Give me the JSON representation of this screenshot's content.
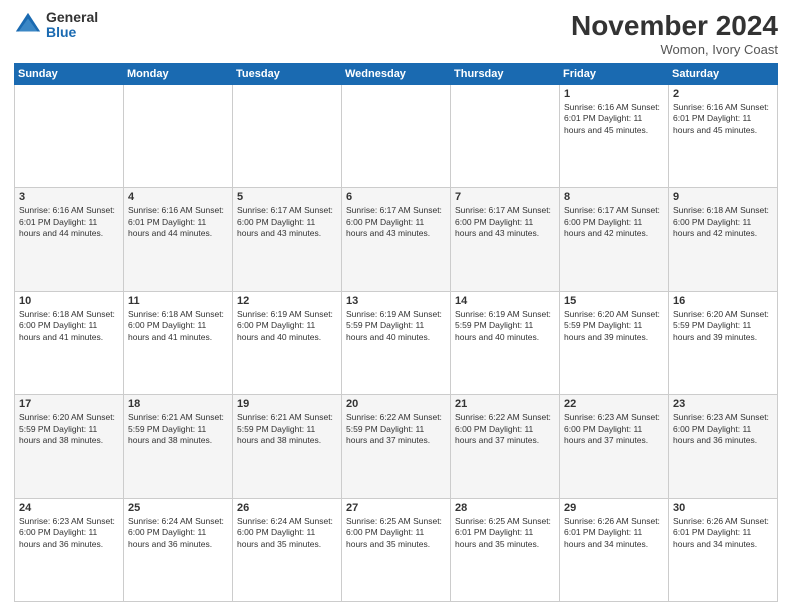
{
  "logo": {
    "general": "General",
    "blue": "Blue"
  },
  "title": "November 2024",
  "location": "Womon, Ivory Coast",
  "days_header": [
    "Sunday",
    "Monday",
    "Tuesday",
    "Wednesday",
    "Thursday",
    "Friday",
    "Saturday"
  ],
  "weeks": [
    [
      {
        "day": "",
        "info": ""
      },
      {
        "day": "",
        "info": ""
      },
      {
        "day": "",
        "info": ""
      },
      {
        "day": "",
        "info": ""
      },
      {
        "day": "",
        "info": ""
      },
      {
        "day": "1",
        "info": "Sunrise: 6:16 AM\nSunset: 6:01 PM\nDaylight: 11 hours\nand 45 minutes."
      },
      {
        "day": "2",
        "info": "Sunrise: 6:16 AM\nSunset: 6:01 PM\nDaylight: 11 hours\nand 45 minutes."
      }
    ],
    [
      {
        "day": "3",
        "info": "Sunrise: 6:16 AM\nSunset: 6:01 PM\nDaylight: 11 hours\nand 44 minutes."
      },
      {
        "day": "4",
        "info": "Sunrise: 6:16 AM\nSunset: 6:01 PM\nDaylight: 11 hours\nand 44 minutes."
      },
      {
        "day": "5",
        "info": "Sunrise: 6:17 AM\nSunset: 6:00 PM\nDaylight: 11 hours\nand 43 minutes."
      },
      {
        "day": "6",
        "info": "Sunrise: 6:17 AM\nSunset: 6:00 PM\nDaylight: 11 hours\nand 43 minutes."
      },
      {
        "day": "7",
        "info": "Sunrise: 6:17 AM\nSunset: 6:00 PM\nDaylight: 11 hours\nand 43 minutes."
      },
      {
        "day": "8",
        "info": "Sunrise: 6:17 AM\nSunset: 6:00 PM\nDaylight: 11 hours\nand 42 minutes."
      },
      {
        "day": "9",
        "info": "Sunrise: 6:18 AM\nSunset: 6:00 PM\nDaylight: 11 hours\nand 42 minutes."
      }
    ],
    [
      {
        "day": "10",
        "info": "Sunrise: 6:18 AM\nSunset: 6:00 PM\nDaylight: 11 hours\nand 41 minutes."
      },
      {
        "day": "11",
        "info": "Sunrise: 6:18 AM\nSunset: 6:00 PM\nDaylight: 11 hours\nand 41 minutes."
      },
      {
        "day": "12",
        "info": "Sunrise: 6:19 AM\nSunset: 6:00 PM\nDaylight: 11 hours\nand 40 minutes."
      },
      {
        "day": "13",
        "info": "Sunrise: 6:19 AM\nSunset: 5:59 PM\nDaylight: 11 hours\nand 40 minutes."
      },
      {
        "day": "14",
        "info": "Sunrise: 6:19 AM\nSunset: 5:59 PM\nDaylight: 11 hours\nand 40 minutes."
      },
      {
        "day": "15",
        "info": "Sunrise: 6:20 AM\nSunset: 5:59 PM\nDaylight: 11 hours\nand 39 minutes."
      },
      {
        "day": "16",
        "info": "Sunrise: 6:20 AM\nSunset: 5:59 PM\nDaylight: 11 hours\nand 39 minutes."
      }
    ],
    [
      {
        "day": "17",
        "info": "Sunrise: 6:20 AM\nSunset: 5:59 PM\nDaylight: 11 hours\nand 38 minutes."
      },
      {
        "day": "18",
        "info": "Sunrise: 6:21 AM\nSunset: 5:59 PM\nDaylight: 11 hours\nand 38 minutes."
      },
      {
        "day": "19",
        "info": "Sunrise: 6:21 AM\nSunset: 5:59 PM\nDaylight: 11 hours\nand 38 minutes."
      },
      {
        "day": "20",
        "info": "Sunrise: 6:22 AM\nSunset: 5:59 PM\nDaylight: 11 hours\nand 37 minutes."
      },
      {
        "day": "21",
        "info": "Sunrise: 6:22 AM\nSunset: 6:00 PM\nDaylight: 11 hours\nand 37 minutes."
      },
      {
        "day": "22",
        "info": "Sunrise: 6:23 AM\nSunset: 6:00 PM\nDaylight: 11 hours\nand 37 minutes."
      },
      {
        "day": "23",
        "info": "Sunrise: 6:23 AM\nSunset: 6:00 PM\nDaylight: 11 hours\nand 36 minutes."
      }
    ],
    [
      {
        "day": "24",
        "info": "Sunrise: 6:23 AM\nSunset: 6:00 PM\nDaylight: 11 hours\nand 36 minutes."
      },
      {
        "day": "25",
        "info": "Sunrise: 6:24 AM\nSunset: 6:00 PM\nDaylight: 11 hours\nand 36 minutes."
      },
      {
        "day": "26",
        "info": "Sunrise: 6:24 AM\nSunset: 6:00 PM\nDaylight: 11 hours\nand 35 minutes."
      },
      {
        "day": "27",
        "info": "Sunrise: 6:25 AM\nSunset: 6:00 PM\nDaylight: 11 hours\nand 35 minutes."
      },
      {
        "day": "28",
        "info": "Sunrise: 6:25 AM\nSunset: 6:01 PM\nDaylight: 11 hours\nand 35 minutes."
      },
      {
        "day": "29",
        "info": "Sunrise: 6:26 AM\nSunset: 6:01 PM\nDaylight: 11 hours\nand 34 minutes."
      },
      {
        "day": "30",
        "info": "Sunrise: 6:26 AM\nSunset: 6:01 PM\nDaylight: 11 hours\nand 34 minutes."
      }
    ]
  ]
}
